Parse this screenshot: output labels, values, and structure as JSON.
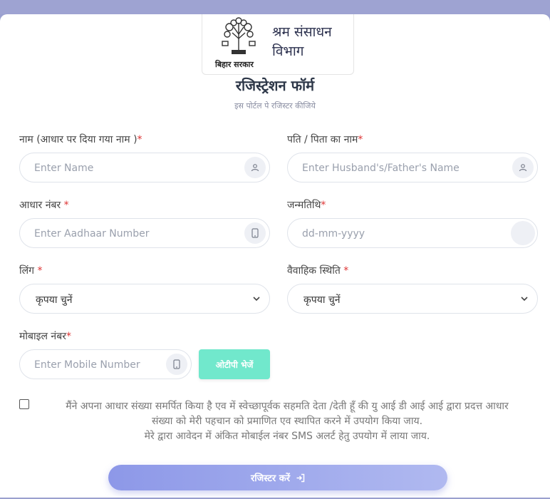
{
  "header": {
    "emblem_caption": "बिहार सरकार",
    "department_line1": "श्रम संसाधन",
    "department_line2": "विभाग"
  },
  "form": {
    "title": "रजिस्ट्रेशन फॉर्म",
    "subtitle": "इस पोर्टल पे रजिस्टर कीजिये",
    "required_marker": "*",
    "name": {
      "label": "नाम (आधार पर दिया गया नाम )",
      "placeholder": "Enter Name",
      "icon": "user-icon"
    },
    "father_name": {
      "label": "पति / पिता का नाम",
      "placeholder": "Enter Husband's/Father's Name",
      "icon": "user-icon"
    },
    "aadhaar": {
      "label": "आधार नंबर ",
      "placeholder": "Enter Aadhaar Number",
      "icon": "mobile-icon"
    },
    "dob": {
      "label": "जन्मतिथि",
      "placeholder": "dd-mm-yyyy"
    },
    "gender": {
      "label": "लिंग ",
      "selected": "कृपया चुनें"
    },
    "marital_status": {
      "label": "वैवाहिक स्थिति ",
      "selected": "कृपया चुनें"
    },
    "mobile": {
      "label": "मोबाइल नंबर",
      "placeholder": "Enter Mobile Number",
      "icon": "mobile-icon"
    },
    "otp_button": "ओटीपी भेजें",
    "consent_line1": "मैंने अपना आधार संख्या समर्पित किया है एव में स्वेच्छापूर्वक सहमति देता /देती हूँ की यु आई डी आई आई द्वारा प्रदत्त आधार",
    "consent_line2": "संख्या को मेरी पहचान को प्रमाणित एव स्थापित करने में उपयोग किया जाय.",
    "consent_line3": "मेरे द्वारा आवेदन में अंकित मोबाईल नंबर SMS अलर्ट हेतु उपयोग में लाया जाय.",
    "submit_label": "रजिस्टर करें"
  },
  "colors": {
    "accent": "#8d98e8",
    "otp_button": "#71e8cc",
    "required": "#dd3333"
  }
}
